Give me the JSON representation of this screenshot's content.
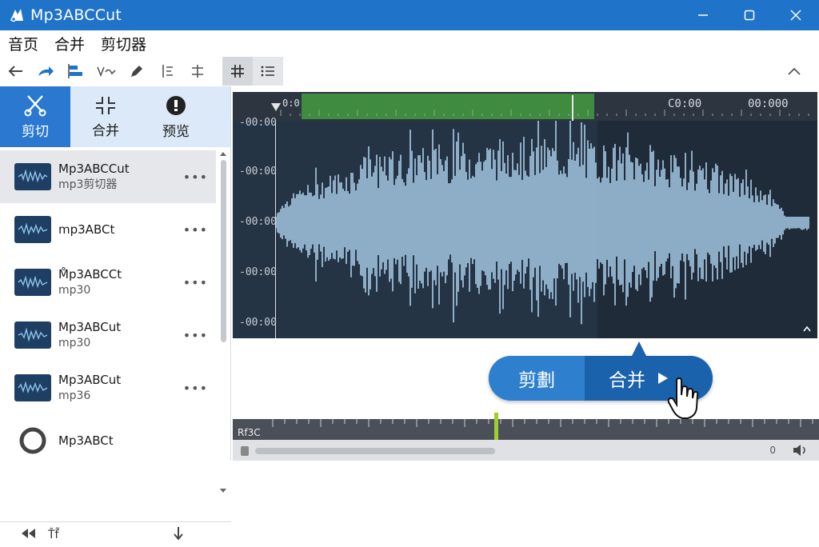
{
  "window": {
    "title": "Mp3ABCCut"
  },
  "menu": [
    "音页",
    "合并",
    "剪切器"
  ],
  "modes": [
    {
      "label": "剪切",
      "icon": "scissors-icon",
      "active": true
    },
    {
      "label": "合并",
      "icon": "merge-icon",
      "active": false
    },
    {
      "label": "预览",
      "icon": "preview-icon",
      "active": false
    }
  ],
  "files": [
    {
      "name": "Mp3ABCCut",
      "sub": "mp3剪切器",
      "selected": true
    },
    {
      "name": "mp3ABCt",
      "sub": "",
      "selected": false
    },
    {
      "name": "M̊p3ABCCt",
      "sub": "mp30",
      "selected": false
    },
    {
      "name": "Mp3ABCut",
      "sub": "mp30",
      "selected": false
    },
    {
      "name": "Mp3ABCut",
      "sub": "mp36",
      "selected": false
    },
    {
      "name": "Mp3ABCt",
      "sub": "",
      "selected": false
    }
  ],
  "waveform": {
    "time_labels": [
      "0:0",
      "C0:00",
      "00:000"
    ],
    "y_labels": [
      "-00:00",
      "-00:00",
      "-00:00",
      "-00:00",
      "-00:00"
    ]
  },
  "actions": {
    "cut": "剪劃",
    "merge": "合并"
  },
  "timeline": {
    "label": "Rf3C"
  },
  "bottombar": {
    "label": "Ťf͂"
  },
  "colors": {
    "accent": "#1f73c8",
    "wave": "#a9cdea",
    "selection": "#3f8b3f"
  }
}
